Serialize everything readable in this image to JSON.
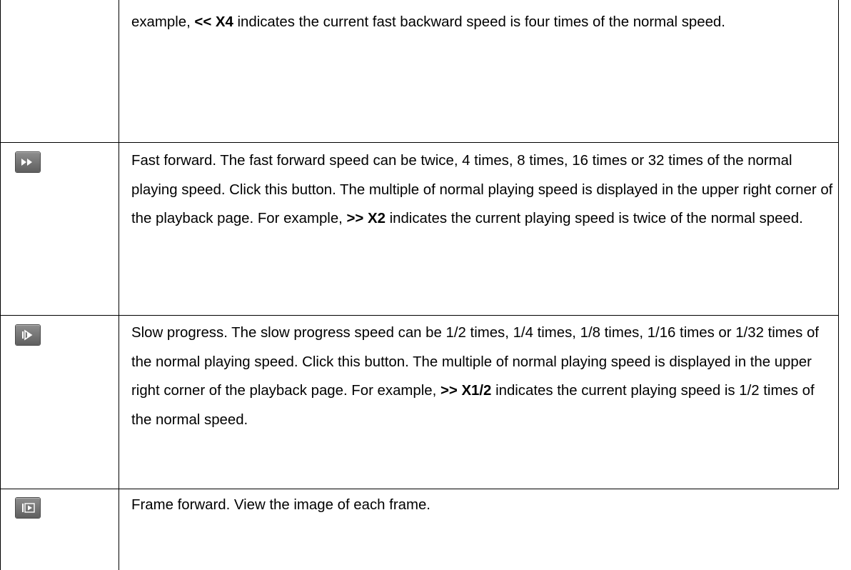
{
  "rows": [
    {
      "icon": null,
      "pre": "example, ",
      "bold": "<< X4",
      "post": " indicates the current fast backward speed is four times of the normal speed."
    },
    {
      "icon": "fast-forward-icon",
      "pre": "Fast forward. The fast forward speed can be twice, 4 times, 8 times, 16 times or 32 times of the normal playing speed. Click this button. The multiple of normal playing speed is displayed in the upper right corner of the playback page. For example, ",
      "bold": ">> X2",
      "post": " indicates the current playing speed is twice of the normal speed."
    },
    {
      "icon": "slow-progress-icon",
      "pre": "Slow progress. The slow progress speed can be 1/2 times, 1/4 times, 1/8 times, 1/16 times or 1/32 times of the normal playing speed. Click this button. The multiple of normal playing speed is displayed in the upper right corner of the playback page. For example, ",
      "bold": ">> X1/2",
      "post": " indicates the current playing speed is 1/2 times of the normal speed."
    },
    {
      "icon": "frame-forward-icon",
      "pre": "Frame forward. View the image of each frame.",
      "bold": "",
      "post": ""
    }
  ]
}
